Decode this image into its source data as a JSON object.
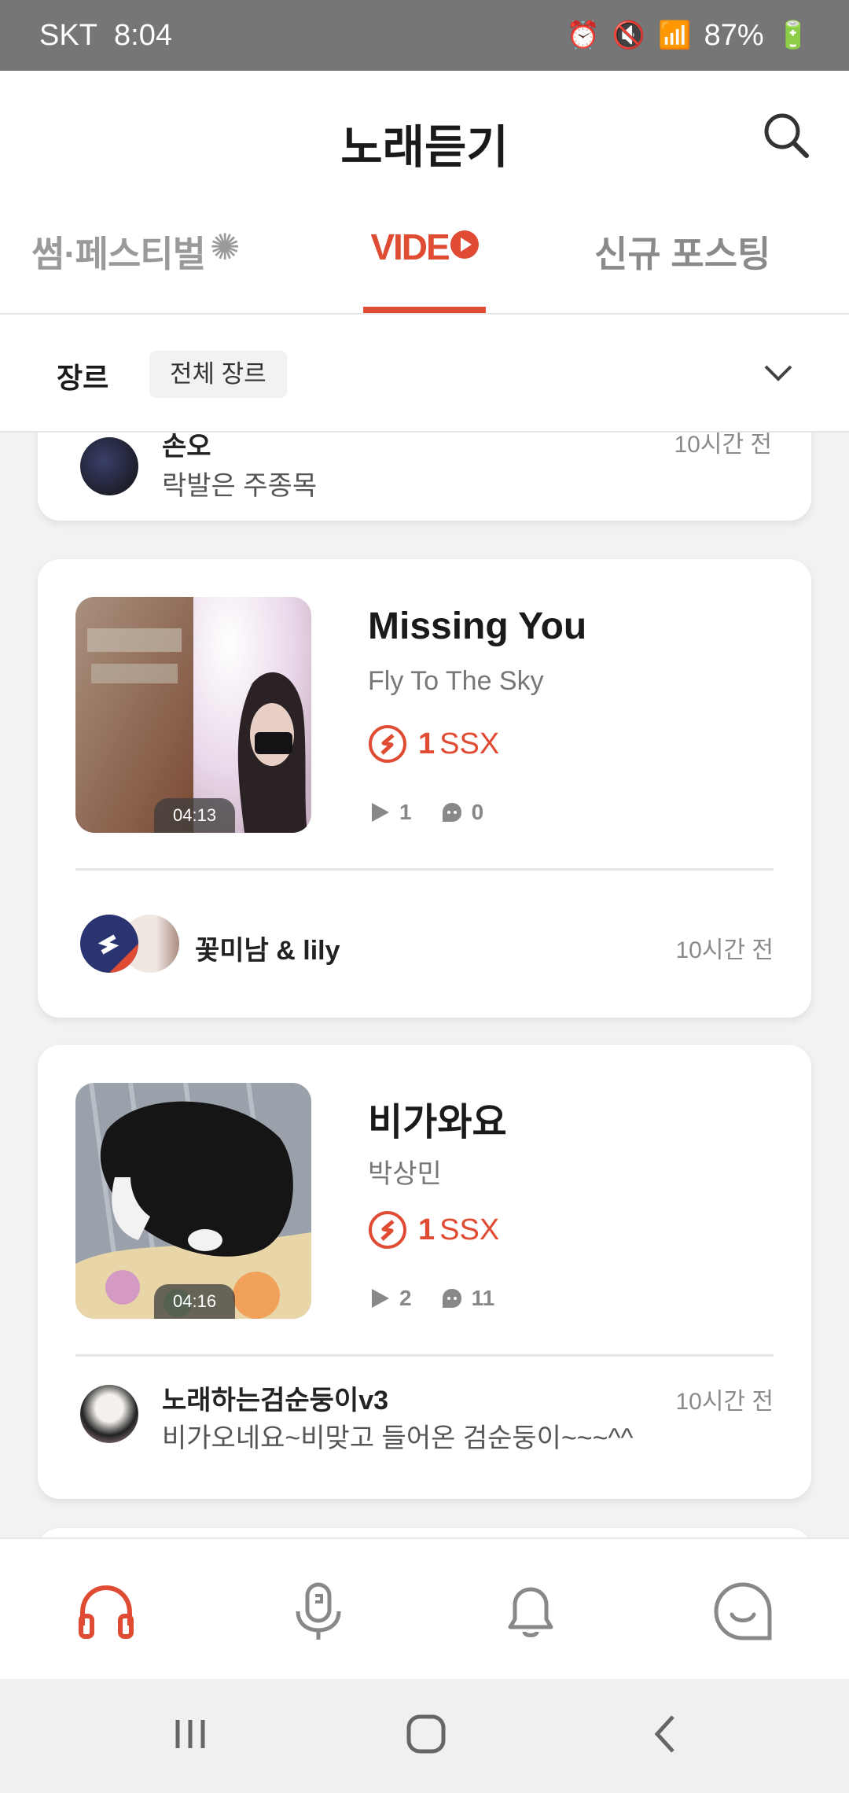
{
  "status_bar": {
    "carrier": "SKT",
    "time": "8:04",
    "battery": "87%"
  },
  "header": {
    "title": "노래듣기"
  },
  "tabs": [
    {
      "label": "썸·페스티벌"
    },
    {
      "label": "VIDE"
    },
    {
      "label": "신규 포스팅"
    }
  ],
  "genre": {
    "label": "장르",
    "selected": "전체 장르"
  },
  "cards": [
    {
      "user_name": "손오",
      "comment": "락발은 주종목",
      "time": "10시간 전"
    },
    {
      "title": "Missing You",
      "artist": "Fly To The Sky",
      "ssx_amount": "1",
      "ssx_unit": "SSX",
      "duration": "04:13",
      "plays": "1",
      "comments": "0",
      "user_name": "꽃미남 & lily",
      "time": "10시간 전"
    },
    {
      "title": "비가와요",
      "artist": "박상민",
      "ssx_amount": "1",
      "ssx_unit": "SSX",
      "duration": "04:16",
      "plays": "2",
      "comments": "11",
      "user_name": "노래하는검순둥이v3",
      "comment": "비가오네요~비맞고 들어온 검순둥이~~~^^",
      "time": "10시간 전"
    }
  ],
  "colors": {
    "accent": "#e04b33",
    "muted": "#8a8a8a"
  }
}
